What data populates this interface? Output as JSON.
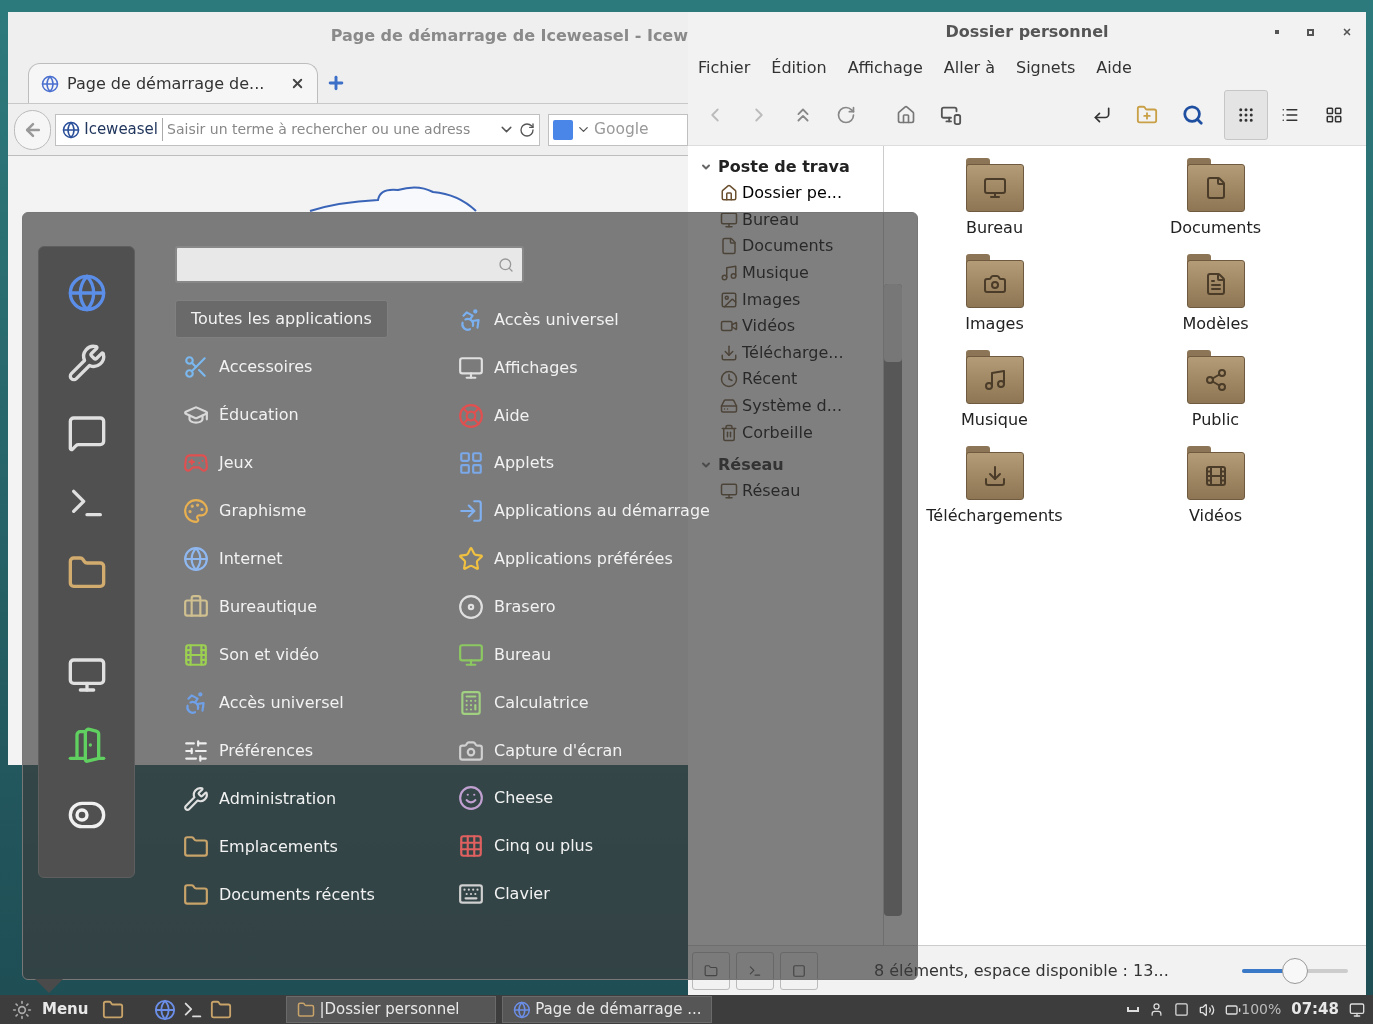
{
  "browser": {
    "title": "Page de démarrage de Iceweasel - Icew",
    "tab": "Page de démarrage de...",
    "identity": "Iceweasel",
    "address_placeholder": "Saisir un terme à rechercher ou une adress",
    "search_placeholder": "Google"
  },
  "file_manager": {
    "title": "Dossier personnel",
    "menu": [
      "Fichier",
      "Édition",
      "Affichage",
      "Aller à",
      "Signets",
      "Aide"
    ],
    "views": [
      {
        "kind": "icons",
        "selected": true
      },
      {
        "kind": "list",
        "selected": false
      },
      {
        "kind": "compact",
        "selected": false
      }
    ],
    "sidebar": [
      {
        "title": "Poste de trava",
        "items": [
          "Dossier pe...",
          "Bureau",
          "Documents",
          "Musique",
          "Images",
          "Vidéos",
          "Télécharge...",
          "Récent",
          "Système d...",
          "Corbeille"
        ]
      },
      {
        "title": "Réseau",
        "items": [
          "Réseau"
        ]
      }
    ],
    "folders": [
      {
        "name": "Bureau",
        "kind": "desktop"
      },
      {
        "name": "Documents",
        "kind": "documents"
      },
      {
        "name": "Images",
        "kind": "pictures"
      },
      {
        "name": "Modèles",
        "kind": "templates"
      },
      {
        "name": "Musique",
        "kind": "music"
      },
      {
        "name": "Public",
        "kind": "public"
      },
      {
        "name": "Téléchargements",
        "kind": "downloads"
      },
      {
        "name": "Vidéos",
        "kind": "videos"
      }
    ],
    "status": "8 éléments, espace disponible : 13...",
    "zoom": {
      "level": 0.5
    }
  },
  "menu": {
    "categories": [
      {
        "label": "Toutes les applications",
        "selected": true
      },
      {
        "label": "Accessoires",
        "selected": false
      },
      {
        "label": "Éducation",
        "selected": false
      },
      {
        "label": "Jeux",
        "selected": false
      },
      {
        "label": "Graphisme",
        "selected": false
      },
      {
        "label": "Internet",
        "selected": false
      },
      {
        "label": "Bureautique",
        "selected": false
      },
      {
        "label": "Son et vidéo",
        "selected": false
      },
      {
        "label": "Accès universel",
        "selected": false
      },
      {
        "label": "Préférences",
        "selected": false
      },
      {
        "label": "Administration",
        "selected": false
      },
      {
        "label": "Emplacements",
        "selected": false
      },
      {
        "label": "Documents récents",
        "selected": false
      }
    ],
    "apps": [
      "Accès universel",
      "Affichages",
      "Aide",
      "Applets",
      "Applications au démarrage",
      "Applications préférées",
      "Brasero",
      "Bureau",
      "Calculatrice",
      "Capture d'écran",
      "Cheese",
      "Cinq ou plus",
      "Clavier"
    ]
  },
  "taskbar": {
    "menu_label": "Menu",
    "windows": [
      "|Dossier personnel",
      "Page de démarrage ..."
    ],
    "battery": "100%",
    "clock": "07:48"
  }
}
